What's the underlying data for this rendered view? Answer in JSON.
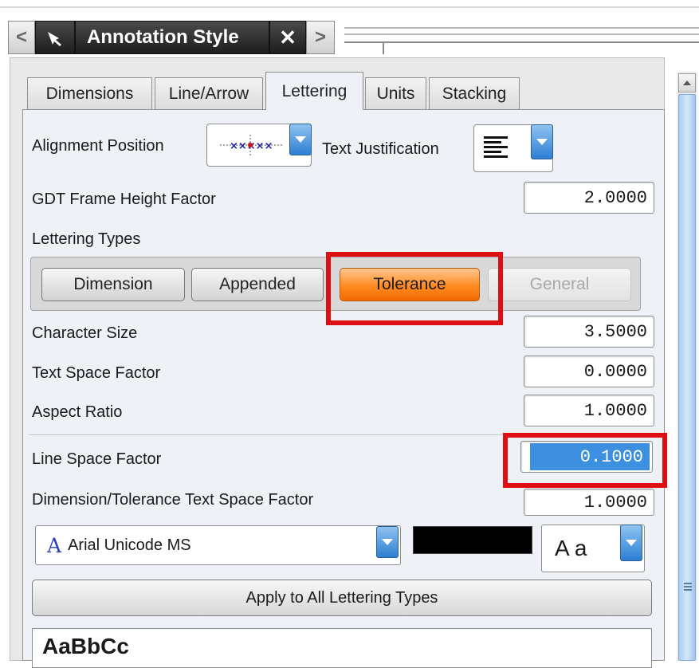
{
  "window": {
    "title": "Annotation Style",
    "buttons": {
      "prev": "<",
      "next": ">",
      "close": "✕"
    }
  },
  "tabs": [
    {
      "label": "Dimensions"
    },
    {
      "label": "Line/Arrow"
    },
    {
      "label": "Lettering",
      "active": true
    },
    {
      "label": "Units"
    },
    {
      "label": "Stacking"
    }
  ],
  "lettering": {
    "alignment_position_label": "Alignment Position",
    "text_justification_label": "Text Justification",
    "gdt_label": "GDT Frame Height Factor",
    "gdt_value": "2.0000",
    "lettering_types_label": "Lettering Types",
    "types": [
      "Dimension",
      "Appended",
      "Tolerance",
      "General"
    ],
    "selected_type": "Tolerance",
    "disabled_type": "General",
    "character_size_label": "Character Size",
    "character_size_value": "3.5000",
    "text_space_factor_label": "Text Space Factor",
    "text_space_factor_value": "0.0000",
    "aspect_ratio_label": "Aspect Ratio",
    "aspect_ratio_value": "1.0000",
    "line_space_factor_label": "Line Space Factor",
    "line_space_factor_value": "0.1000",
    "dim_tol_space_label": "Dimension/Tolerance Text Space Factor",
    "dim_tol_space_value": "1.0000",
    "font_glyph": "A",
    "font_name": "Arial Unicode MS",
    "color_swatch": "#000000",
    "style_sample": "A a",
    "apply_label": "Apply to All Lettering Types",
    "preview_text": "AaBbCc"
  },
  "colors": {
    "highlight_box": "#dd0f12",
    "selected_button": "#ff8a22",
    "selection": "#3d8fe0"
  },
  "icons": {
    "alignment": "alignment-position-icon",
    "justify": "text-justify-left-icon",
    "pin": "pin-icon"
  }
}
